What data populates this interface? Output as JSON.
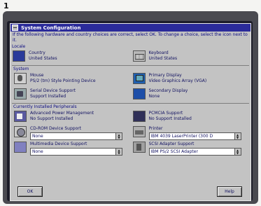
{
  "page_number": "1",
  "window": {
    "title": "System Configuration",
    "instructions": "If the following hardware and country choices are correct, select OK. To change a choice, select the icon next to it."
  },
  "locale": {
    "heading": "Locale",
    "country": {
      "label": "Country",
      "value": "United States",
      "icon": "globe-icon"
    },
    "keyboard": {
      "label": "Keyboard",
      "value": "United States",
      "icon": "keyboard-icon"
    }
  },
  "system": {
    "heading": "System",
    "mouse": {
      "label": "Mouse",
      "value": "PS/2 (tm) Style Pointing Device",
      "icon": "mouse-icon"
    },
    "primary_display": {
      "label": "Primary Display",
      "value": "Video Graphics Array (VGA)",
      "icon": "display-icon"
    },
    "serial": {
      "label": "Serial Device Support",
      "value": "Support Installed",
      "icon": "serial-port-icon"
    },
    "secondary_display": {
      "label": "Secondary Display",
      "value": "None",
      "icon": "secondary-display-icon"
    }
  },
  "peripherals": {
    "heading": "Currently Installed Peripherals",
    "power": {
      "label": "Advanced Power Management",
      "value": "No Support Installed",
      "icon": "power-icon"
    },
    "pcmcia": {
      "label": "PCMCIA Support",
      "value": "No Support Installed",
      "icon": "pcmcia-card-icon"
    },
    "cdrom": {
      "label": "CD-ROM Device Support",
      "value": "None",
      "icon": "cdrom-icon"
    },
    "printer": {
      "label": "Printer",
      "value": "IBM 4039 LaserPrinter (300 D",
      "icon": "printer-icon"
    },
    "multimedia": {
      "label": "Multimedia Device Support",
      "value": "None",
      "icon": "multimedia-icon"
    },
    "scsi": {
      "label": "SCSI Adapter Support",
      "value": "IBM PS/2 SCSI Adapter",
      "icon": "scsi-adapter-icon"
    }
  },
  "buttons": {
    "ok": "OK",
    "help": "Help"
  },
  "colors": {
    "titlebar": "#2b2b9a",
    "window_bg": "#c3c3c3",
    "text": "#101060"
  }
}
